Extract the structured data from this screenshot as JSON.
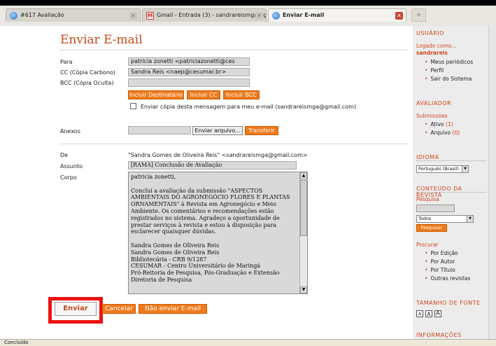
{
  "tabs": [
    {
      "label": "#617 Avaliação"
    },
    {
      "label": "Gmail - Entrada (3) - sandrareismga@g..."
    },
    {
      "label": "Enviar E-mail"
    }
  ],
  "page": {
    "title": "Enviar E-mail"
  },
  "form": {
    "para_label": "Para",
    "para_value": "patricia zonetti <patriciazonetti@ces",
    "cc_label": "CC (Cópia Carbono)",
    "cc_value": "Sandra Reis <naep@cesumar.br>",
    "bcc_label": "BCC (Cópia Oculta)",
    "bcc_value": "",
    "btn_incluir_destinatario": "Incluir Destinatário",
    "btn_incluir_cc": "Incluir CC",
    "btn_incluir_bcc": "Incluir BCC",
    "copy_checkbox_label": "Enviar cópia desta mensagem para meu e-mail (sandrareismga@gmail.com)",
    "anexos_label": "Anexos",
    "btn_enviar_arquivo": "Enviar arquivo...",
    "btn_transferir": "Transferir",
    "de_label": "De",
    "de_value": "\"Sandra Gomes de Oliveira Reis\" <sandrareismga@gmail.com>",
    "assunto_label": "Assunto",
    "assunto_value": "[RAMA] Conclusão de Avaliação",
    "corpo_label": "Corpo",
    "corpo_paragraphs": [
      "patricia zonetti,",
      "Concluí a avaliação da submissão \"ASPECTOS AMBIENTAIS DO AGRONEGÓCIO FLORES E PLANTAS ORNAMENTAIS\" à Revista em Agronegócio e Meio Ambiente. Os comentários e recomendações estão registrados no sistema. Agradeço a oportunidade de prestar serviços à revista e estou à disposição para esclarecer quaisquer dúvidas."
    ],
    "corpo_signature": [
      "Sandra Gomes de Oliveira Reis",
      "Sandra Gomes de Oliveira Reis",
      "Bibliotecária - CRB 9/1287",
      "CESUMAR - Centro Universitário de Maringá",
      "Pró-Reitoria de Pesquisa, Pós-Graduação e Extensão",
      "Diretoria de Pesquisa"
    ],
    "btn_enviar": "Enviar",
    "btn_cancelar": "Cancelar",
    "btn_nao_enviar": "Não enviar E-mail"
  },
  "sidebar": {
    "usuario_heading": "USUÁRIO",
    "logado_como": "Logado como...",
    "username": "sandrareis",
    "user_links": [
      "Meus periódicos",
      "Perfil",
      "Sair do Sistema"
    ],
    "avaliador_heading": "AVALIADOR",
    "submissoes": "Submissões",
    "ativo_label": "Ativo",
    "ativo_count": "(1)",
    "arquivo_label": "Arquivo",
    "arquivo_count": "(0)",
    "idioma_heading": "IDIOMA",
    "idioma_value": "Português (Brasil)",
    "conteudo_heading": "CONTEÚDO DA REVISTA",
    "pesquisa_label": "Pesquisa",
    "search_scope": "Todos",
    "btn_pesquisar": "Pesquisar",
    "procurar_label": "Procurar",
    "procurar_links": [
      "Por Edição",
      "Por Autor",
      "Por Título",
      "Outras revistas"
    ],
    "tamanho_heading": "TAMANHO DE FONTE",
    "font_sizes": [
      "A",
      "A",
      "A"
    ],
    "informacoes_heading": "INFORMAÇÕES"
  },
  "status": {
    "text": "Concluído"
  },
  "colors": {
    "accent": "#ee7a1c",
    "title": "#c04a1a",
    "highlight": "#ee1111"
  }
}
